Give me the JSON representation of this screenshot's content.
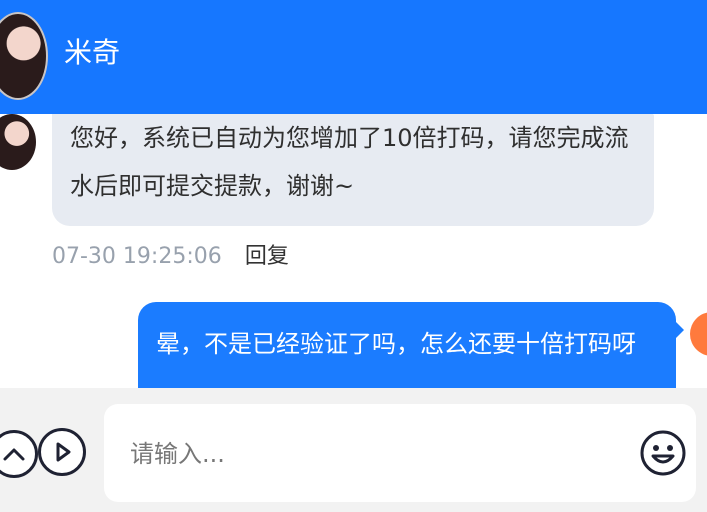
{
  "header": {
    "title": "米奇"
  },
  "messages": [
    {
      "direction": "incoming",
      "text": "您好，系统已自动为您增加了10倍打码，请您完成流水后即可提交提款，谢谢~"
    },
    {
      "direction": "outgoing",
      "text": "晕，不是已经验证了吗，怎么还要十倍打码呀"
    }
  ],
  "meta": {
    "time": "07-30 19:25:06",
    "reply": "回复"
  },
  "input": {
    "placeholder": "请输入..."
  },
  "icons": {
    "left": "chevron-up-icon",
    "play": "play-icon",
    "emoji": "emoji-icon"
  },
  "colors": {
    "header": "#1677ff",
    "incoming_bubble": "#e7ebf2",
    "outgoing_bubble": "#1b7cff",
    "self_avatar": "#ff7a3d"
  }
}
